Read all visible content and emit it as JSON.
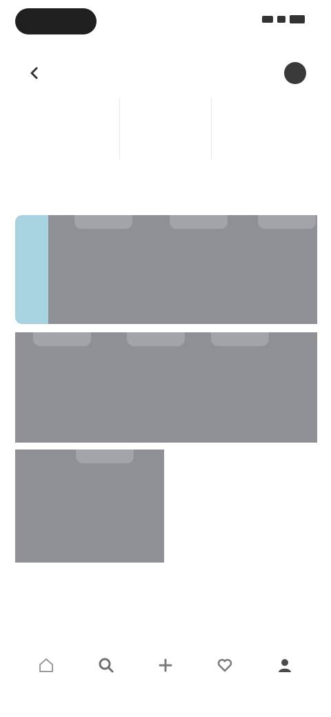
{
  "status_bar": {
    "time": ""
  },
  "header": {
    "title": ""
  },
  "stats": [
    {
      "value": "",
      "label": ""
    },
    {
      "value": "",
      "label": ""
    },
    {
      "value": "",
      "label": ""
    }
  ],
  "note": "",
  "tiles": [
    {
      "caption": "",
      "selected": true
    },
    {
      "caption": "",
      "selected": false
    },
    {
      "caption": "",
      "selected": false
    },
    {
      "caption": "",
      "selected": false
    },
    {
      "caption": "",
      "selected": false
    },
    {
      "caption": "",
      "selected": false
    },
    {
      "caption": "",
      "selected": false
    }
  ],
  "bottom_nav": [
    {
      "icon": "home-icon",
      "label": ""
    },
    {
      "icon": "search-icon",
      "label": ""
    },
    {
      "icon": "plus-icon",
      "label": ""
    },
    {
      "icon": "heart-icon",
      "label": ""
    },
    {
      "icon": "profile-icon",
      "label": ""
    }
  ],
  "colors": {
    "tile": "#8f9096",
    "selected": "#a7d2df",
    "text": "#2a2a2a"
  }
}
